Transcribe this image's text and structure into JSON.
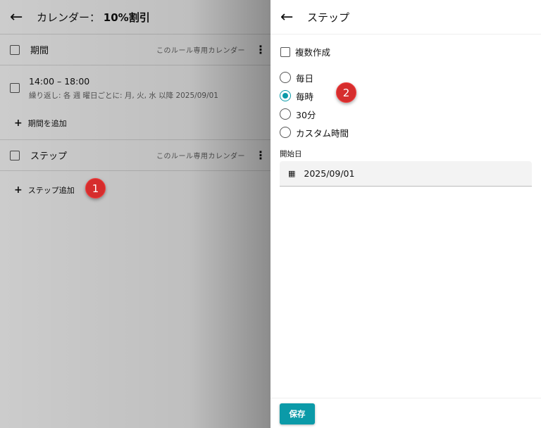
{
  "left": {
    "back_icon": "arrow-left",
    "title_prefix": "カレンダー：",
    "title_name": "10%割引",
    "period_section": {
      "label": "期間",
      "meta": "このルール専用カレンダー"
    },
    "period_item": {
      "time": "14:00 – 18:00",
      "detail": "繰り返し: 各 週 曜日ごとに: 月, 火, 水 以降 2025/09/01"
    },
    "add_period": "期間を追加",
    "step_section": {
      "label": "ステップ",
      "meta": "このルール専用カレンダー"
    },
    "add_step": "ステップ追加",
    "badge": "1"
  },
  "right": {
    "title": "ステップ",
    "multi_create": "複数作成",
    "options": [
      {
        "label": "毎日",
        "selected": false
      },
      {
        "label": "毎時",
        "selected": true
      },
      {
        "label": "30分",
        "selected": false
      },
      {
        "label": "カスタム時間",
        "selected": false
      }
    ],
    "start_label": "開始日",
    "start_value": "2025/09/01",
    "badge": "2",
    "save": "保存"
  },
  "colors": {
    "accent": "#0b9aa8",
    "badge": "#d62d2d"
  }
}
